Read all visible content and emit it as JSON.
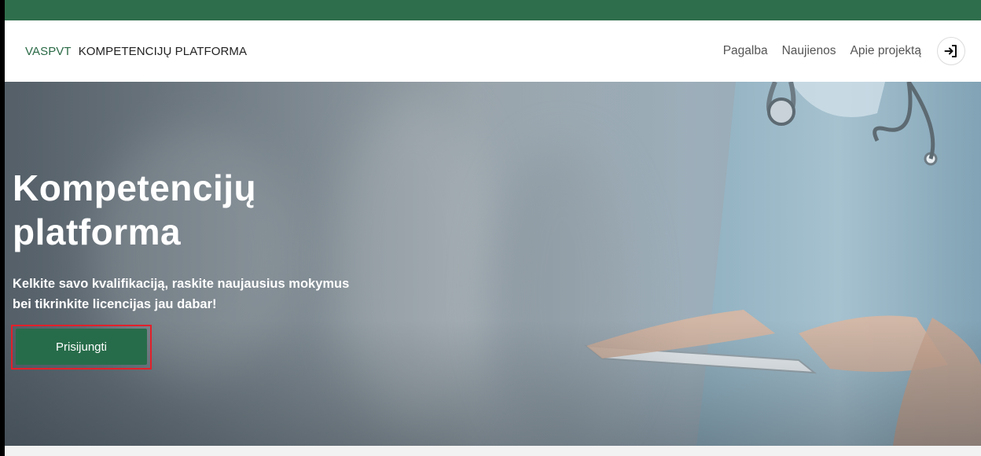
{
  "header": {
    "brand_short": "VASPVT",
    "brand_long": "KOMPETENCIJŲ PLATFORMA",
    "nav": [
      "Pagalba",
      "Naujienos",
      "Apie projektą"
    ],
    "login_icon": "login-arrow-icon"
  },
  "hero": {
    "title_line1": "Kompetencijų",
    "title_line2": "platforma",
    "subtitle_line1": "Kelkite savo kvalifikaciją, raskite naujausius mokymus",
    "subtitle_line2": "bei tikrinkite licencijas jau dabar!",
    "cta_label": "Prisijungti"
  },
  "colors": {
    "brand_green": "#2f6e4c",
    "button_green": "#276c4a",
    "highlight_red": "#e2202a"
  }
}
